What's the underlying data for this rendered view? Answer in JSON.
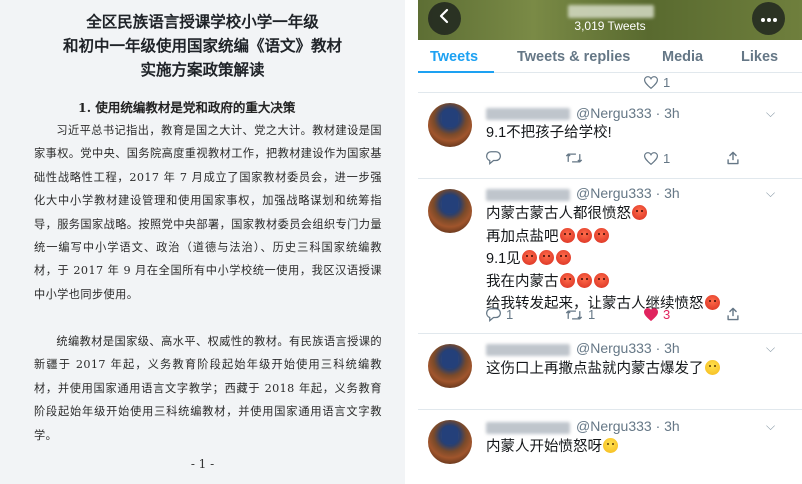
{
  "document": {
    "title_line1": "全区民族语言授课学校小学一年级",
    "title_line2": "和初中一年级使用国家统编《语文》教材",
    "title_line3": "实施方案政策解读",
    "section_heading": "1. 使用统编教材是党和政府的重大决策",
    "paragraph1": "习近平总书记指出，教育是国之大计、党之大计。教材建设是国家事权。党中央、国务院高度重视教材工作，把教材建设作为国家基础性战略性工程，2017 年 7 月成立了国家教材委员会，进一步强化大中小学教材建设管理和使用国家事权，加强战略谋划和统筹指导，服务国家战略。按照党中央部署，国家教材委员会组织专门力量统一编写中小学语文、政治（道德与法治）、历史三科国家统编教材，于 2017 年 9 月在全国所有中小学校统一使用，我区汉语授课中小学也同步使用。",
    "paragraph2": "统编教材是国家级、高水平、权威性的教材。有民族语言授课的新疆于 2017 年起，义务教育阶段起始年级开始使用三科统编教材，并使用国家通用语言文字教学；西藏于 2018 年起，义务教育阶段起始年级开始使用三科统编教材，并使用国家通用语言文字教学。",
    "page_number": "- 1 -"
  },
  "twitter": {
    "tweet_count": "3,019 Tweets",
    "tabs": [
      {
        "label": "Tweets",
        "active": true
      },
      {
        "label": "Tweets & replies",
        "active": false
      },
      {
        "label": "Media",
        "active": false
      },
      {
        "label": "Likes",
        "active": false
      }
    ],
    "prev_tweet_actions": {
      "likes": "1"
    },
    "tweets": [
      {
        "handle": "@Nergu333 · 3h",
        "lines": [
          "9.1不把孩子给学校!"
        ],
        "emojis": [
          []
        ],
        "replies": "",
        "retweets": "",
        "likes": "1",
        "liked": false
      },
      {
        "handle": "@Nergu333 · 3h",
        "lines": [
          "内蒙古蒙古人都很愤怒",
          "再加点盐吧",
          "9.1见",
          "我在内蒙古",
          "给我转发起来，让蒙古人继续愤怒"
        ],
        "emojis": [
          [
            "angry"
          ],
          [
            "angry",
            "angry",
            "angry"
          ],
          [
            "angry",
            "angry",
            "angry"
          ],
          [
            "angry",
            "angry",
            "angry"
          ],
          [
            "angry"
          ]
        ],
        "replies": "1",
        "retweets": "1",
        "likes": "3",
        "liked": true
      },
      {
        "handle": "@Nergu333 · 3h",
        "lines": [
          "这伤口上再撒点盐就内蒙古爆发了"
        ],
        "emojis": [
          [
            "think"
          ]
        ],
        "replies": "",
        "retweets": "",
        "likes": "",
        "liked": false
      },
      {
        "handle": "@Nergu333 · 3h",
        "lines": [
          "内蒙人开始愤怒呀"
        ],
        "emojis": [
          [
            "think"
          ]
        ],
        "replies": "",
        "retweets": "",
        "likes": "",
        "liked": false
      }
    ],
    "icons": {
      "back": "arrow-left-icon",
      "more": "more-horizontal-icon",
      "reply": "reply-icon",
      "retweet": "retweet-icon",
      "like": "heart-icon",
      "caret": "chevron-down-icon"
    },
    "colors": {
      "accent": "#1da1f2",
      "like": "#e0245e",
      "muted": "#657786",
      "banner": "#6f7f3d"
    }
  }
}
